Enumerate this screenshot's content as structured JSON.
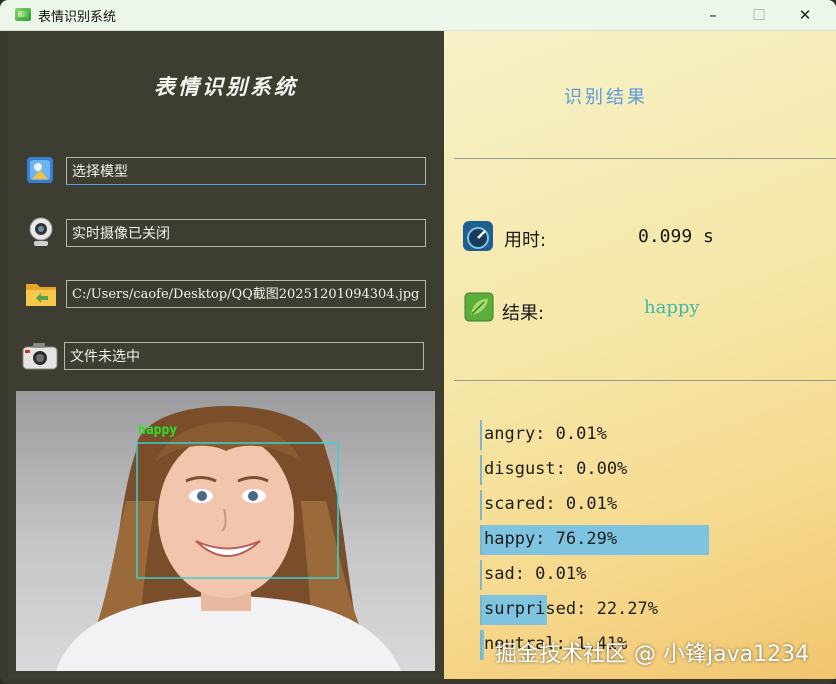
{
  "window": {
    "title": "表情识别系统",
    "min_label": "–",
    "max_label": "☐",
    "close_label": "✕"
  },
  "left": {
    "app_title": "表情识别系统",
    "model_field": "选择模型",
    "camera_field": "实时摄像已关闭",
    "file_path": "C:/Users/caofe/Desktop/QQ截图20251201094304.jpg",
    "capture_field": "文件未选中",
    "face_label": "happy"
  },
  "result": {
    "title": "识别结果",
    "time_label": "用时:",
    "time_value": "0.099  s",
    "result_label": "结果:",
    "result_value": "happy"
  },
  "probabilities": [
    {
      "label": "angry: 0.01%",
      "value": 0.01
    },
    {
      "label": "disgust: 0.00%",
      "value": 0.0
    },
    {
      "label": "scared: 0.01%",
      "value": 0.01
    },
    {
      "label": "happy: 76.29%",
      "value": 76.29
    },
    {
      "label": "sad: 0.01%",
      "value": 0.01
    },
    {
      "label": "surprised: 22.27%",
      "value": 22.27
    },
    {
      "label": "neutral: 1.41%",
      "value": 1.41
    }
  ],
  "watermark": "掘金技术社区 @ 小锋java1234",
  "colors": {
    "left_bg": "#3d3d32",
    "bar": "#7ec3df",
    "result_title": "#5a9be0",
    "result_value": "#3fb8a8",
    "face_box": "#3ad1d4",
    "face_text": "#29e02a"
  },
  "icons": {
    "model": "folder-image-icon",
    "camera": "webcam-icon",
    "file": "folder-open-icon",
    "capture": "photo-camera-icon",
    "timer": "speedometer-icon",
    "result": "leaf-icon"
  }
}
